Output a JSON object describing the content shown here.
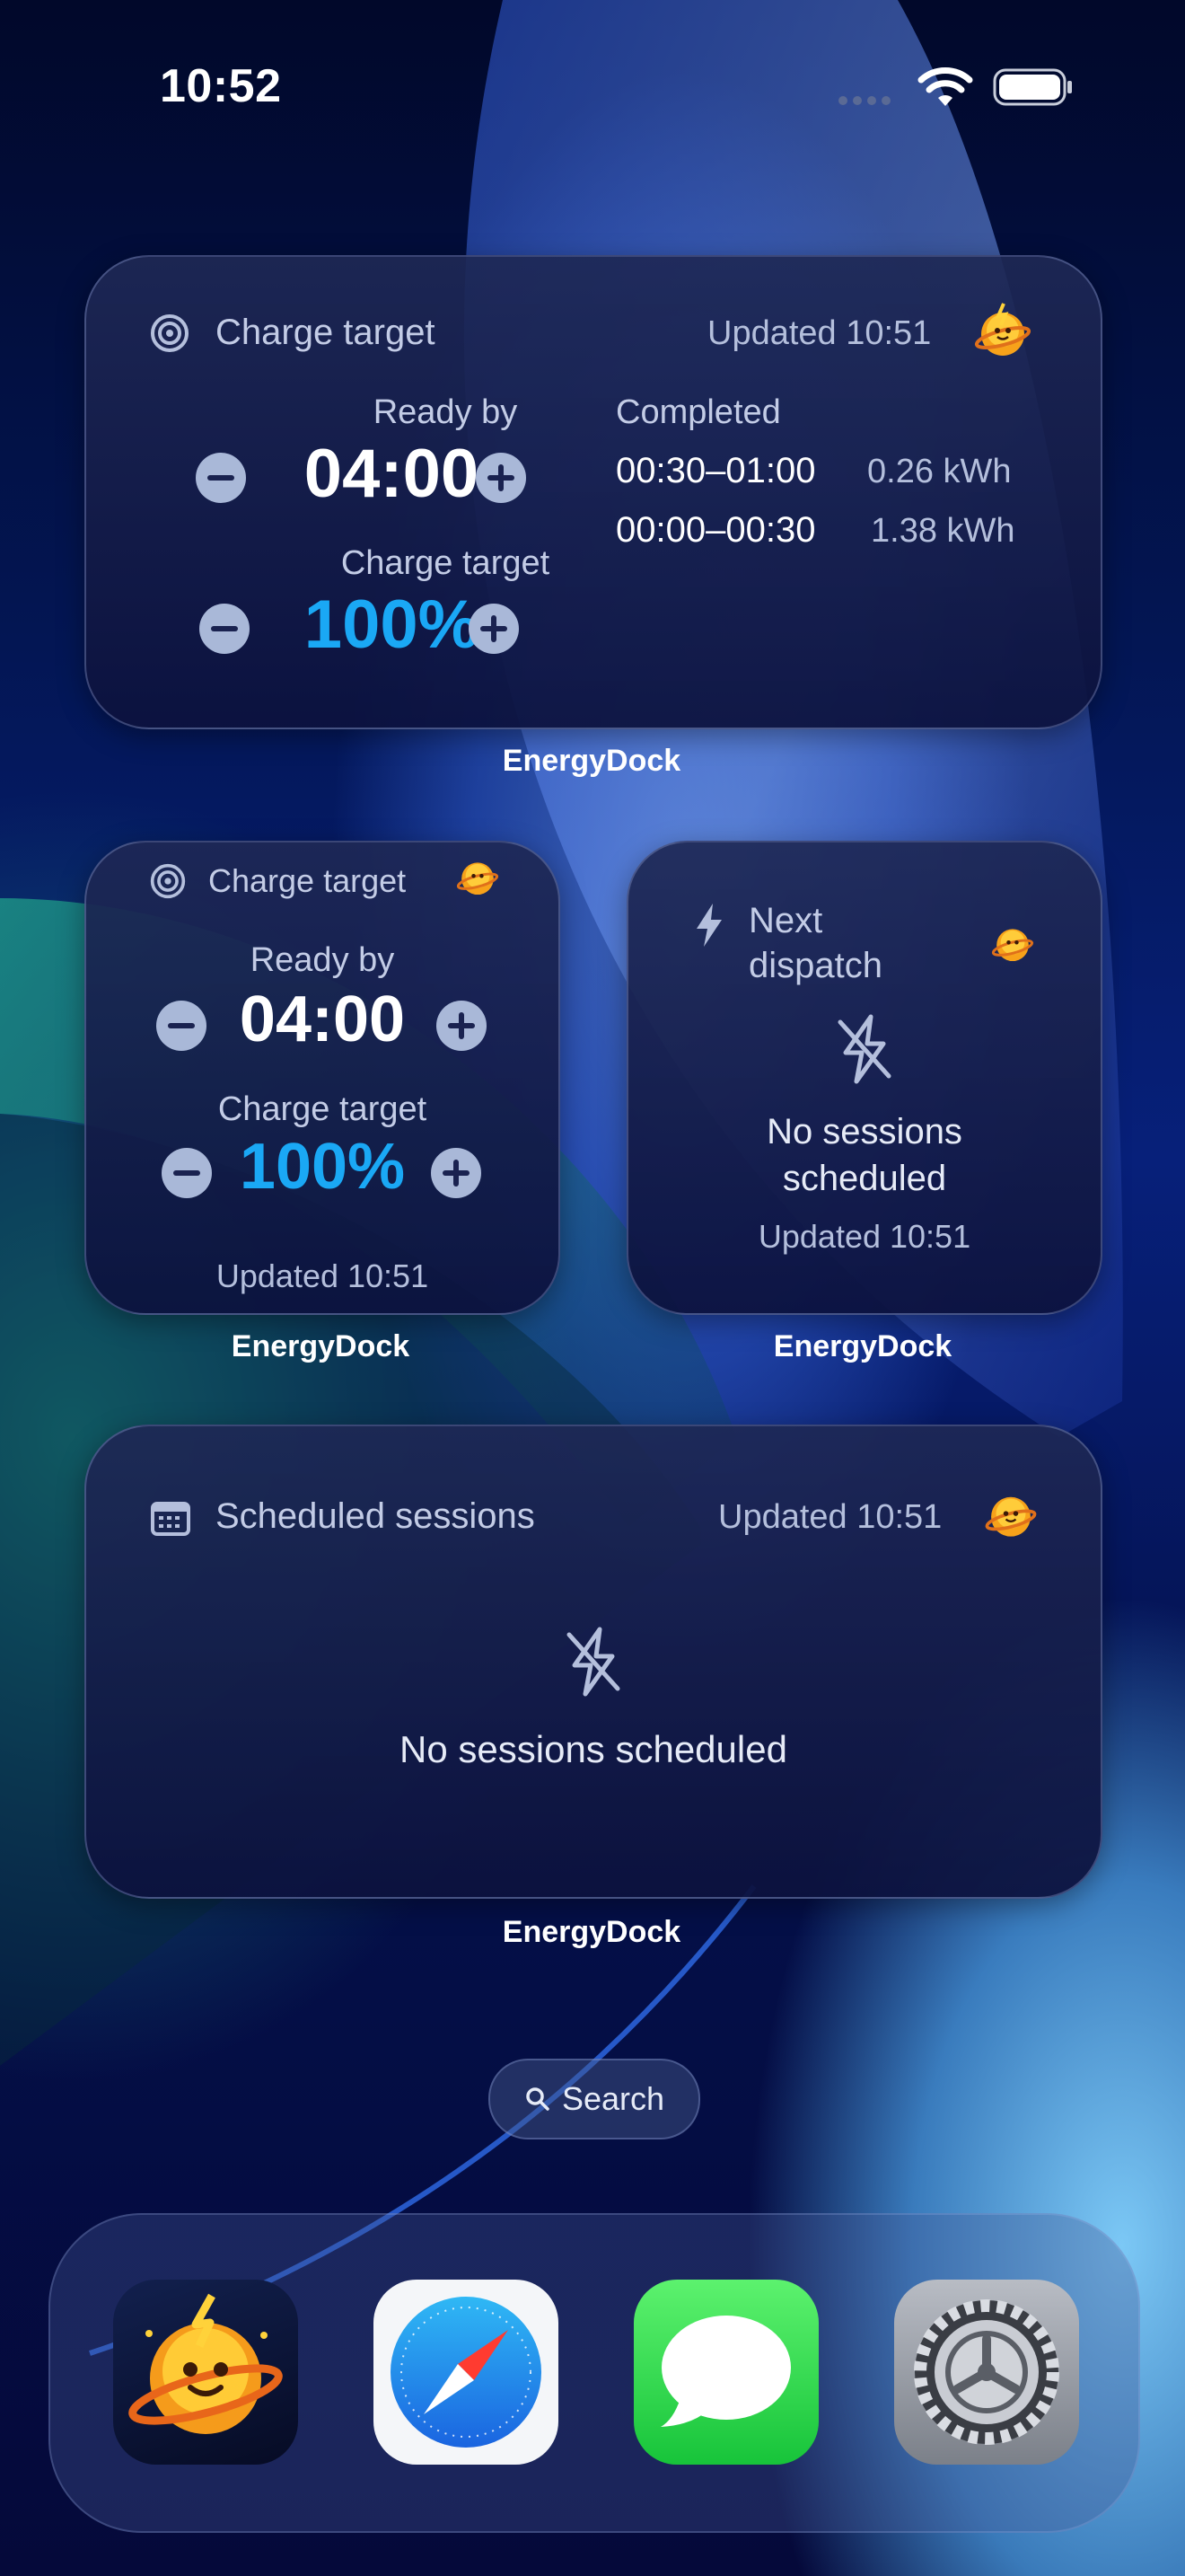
{
  "status_bar": {
    "time": "10:52"
  },
  "widget_large_charge": {
    "title": "Charge target",
    "updated": "Updated 10:51",
    "ready_by_label": "Ready by",
    "ready_by_value": "04:00",
    "charge_target_label": "Charge target",
    "charge_target_value": "100%",
    "completed_label": "Completed",
    "completed_sessions": [
      {
        "range": "00:30–01:00",
        "energy": "0.26 kWh"
      },
      {
        "range": "00:00–00:30",
        "energy": "1.38 kWh"
      }
    ],
    "app_label": "EnergyDock"
  },
  "widget_small_charge": {
    "title": "Charge target",
    "ready_by_label": "Ready by",
    "ready_by_value": "04:00",
    "charge_target_label": "Charge target",
    "charge_target_value": "100%",
    "updated": "Updated 10:51",
    "app_label": "EnergyDock"
  },
  "widget_next_dispatch": {
    "title_line1": "Next",
    "title_line2": "dispatch",
    "empty_line1": "No sessions",
    "empty_line2": "scheduled",
    "updated": "Updated 10:51",
    "app_label": "EnergyDock"
  },
  "widget_scheduled": {
    "title": "Scheduled sessions",
    "updated": "Updated 10:51",
    "empty": "No sessions scheduled",
    "app_label": "EnergyDock"
  },
  "search": {
    "label": "Search"
  },
  "dock": {
    "apps": [
      "EnergyDock",
      "Safari",
      "Messages",
      "Settings"
    ]
  },
  "colors": {
    "accent": "#1aa8f5",
    "button": "#a9b8d8"
  }
}
